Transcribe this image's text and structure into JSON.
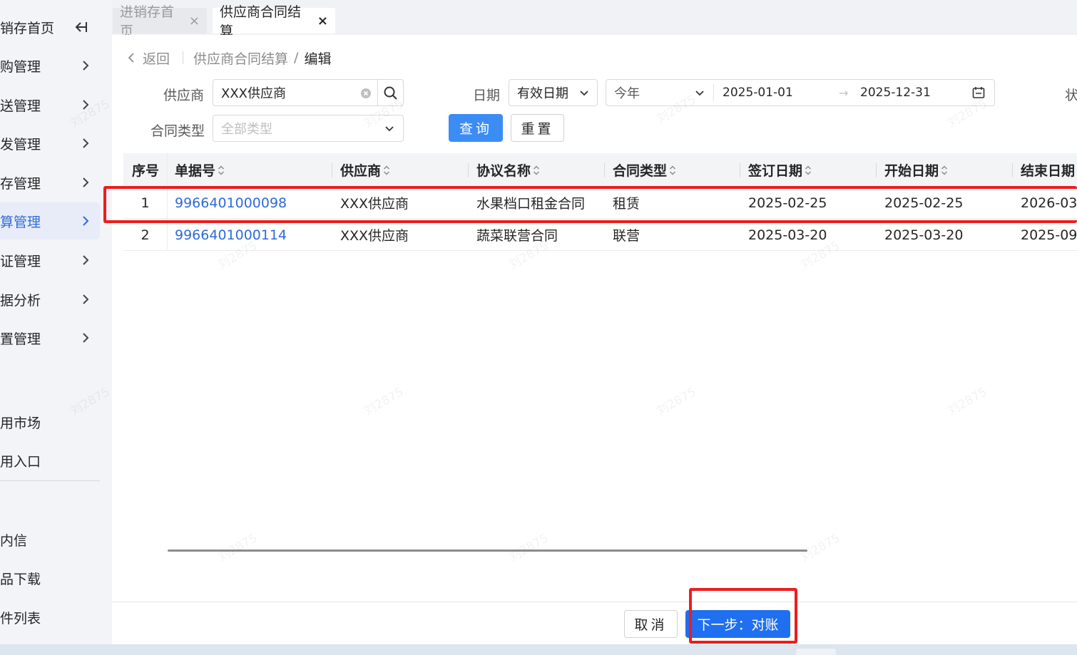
{
  "sidebar": {
    "items": [
      {
        "label": "销存首页"
      },
      {
        "label": "购管理"
      },
      {
        "label": "送管理"
      },
      {
        "label": "发管理"
      },
      {
        "label": "存管理"
      },
      {
        "label": "算管理"
      },
      {
        "label": "证管理"
      },
      {
        "label": "据分析"
      },
      {
        "label": "置管理"
      },
      {
        "label": "用市场"
      },
      {
        "label": "用入口"
      },
      {
        "label": "内信"
      },
      {
        "label": "品下载"
      },
      {
        "label": "件列表"
      }
    ],
    "active_item": "算管理"
  },
  "tabs": [
    {
      "label": "进销存首页",
      "close": "×"
    },
    {
      "label": "供应商合同结算",
      "close": "×"
    }
  ],
  "breadcrumb": {
    "back": "返回",
    "parent": "供应商合同结算",
    "separator": "/",
    "current": "编辑"
  },
  "filters": {
    "supplier_label": "供应商",
    "supplier_value": "XXX供应商",
    "date_label": "日期",
    "date_type": "有效日期",
    "date_range_preset": "今年",
    "date_start": "2025-01-01",
    "date_arrow": "→",
    "date_end": "2025-12-31",
    "status_label_partial": "状",
    "contract_type_label": "合同类型",
    "contract_type_placeholder": "全部类型"
  },
  "buttons": {
    "query": "查询",
    "reset": "重置",
    "cancel": "取消",
    "next": "下一步：对账"
  },
  "table": {
    "columns": [
      "序号",
      "单据号",
      "供应商",
      "协议名称",
      "合同类型",
      "签订日期",
      "开始日期",
      "结束日期"
    ],
    "rows": [
      {
        "idx": "1",
        "doc_no": "9966401000098",
        "supplier": "XXX供应商",
        "agreement": "水果档口租金合同",
        "type": "租赁",
        "sign_date": "2025-02-25",
        "start_date": "2025-02-25",
        "end_date": "2026-03-"
      },
      {
        "idx": "2",
        "doc_no": "9966401000114",
        "supplier": "XXX供应商",
        "agreement": "蔬菜联营合同",
        "type": "联营",
        "sign_date": "2025-03-20",
        "start_date": "2025-03-20",
        "end_date": "2025-09-"
      }
    ]
  },
  "watermark_text": "刘2875",
  "colors": {
    "accent": "#3c8cf5",
    "link": "#2f6ad9",
    "annotation": "#ee1c1c"
  }
}
